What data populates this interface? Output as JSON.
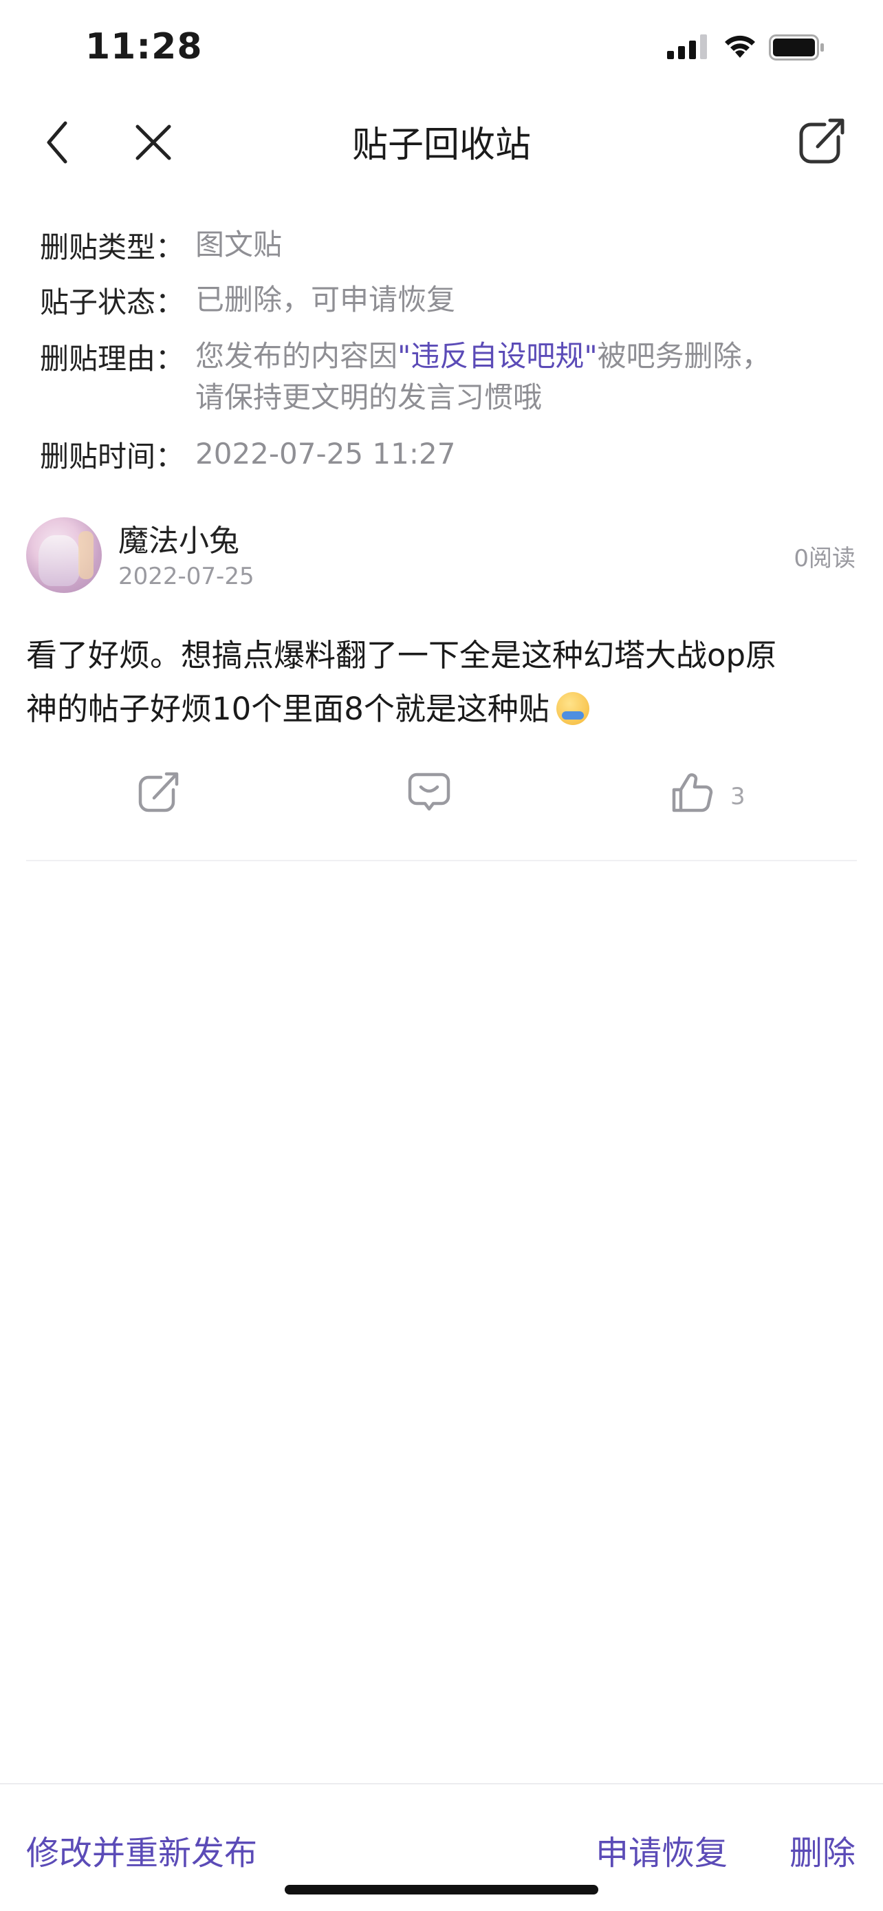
{
  "status_bar": {
    "time": "11:28"
  },
  "nav": {
    "title": "贴子回收站"
  },
  "info": {
    "type_label": "删贴类型：",
    "type_value": "图文贴",
    "status_label": "贴子状态：",
    "status_value": "已删除，可申请恢复",
    "reason_label": "删贴理由：",
    "reason_prefix": "您发布的内容因",
    "reason_link": "\"违反自设吧规\"",
    "reason_suffix": "被吧务删除，",
    "reason_line2": "请保持更文明的发言习惯哦",
    "time_label": "删贴时间：",
    "time_value": "2022-07-25 11:27"
  },
  "post": {
    "author": "魔法小兔",
    "date": "2022-07-25",
    "reads": "0阅读",
    "body_line1": "看了好烦。想搞点爆料翻了一下全是这种幻塔大战op原",
    "body_line2": "神的帖子好烦10个里面8个就是这种贴",
    "likes": "3"
  },
  "bottom": {
    "edit_label": "修改并重新发布",
    "restore_label": "申请恢复",
    "delete_label": "删除"
  }
}
